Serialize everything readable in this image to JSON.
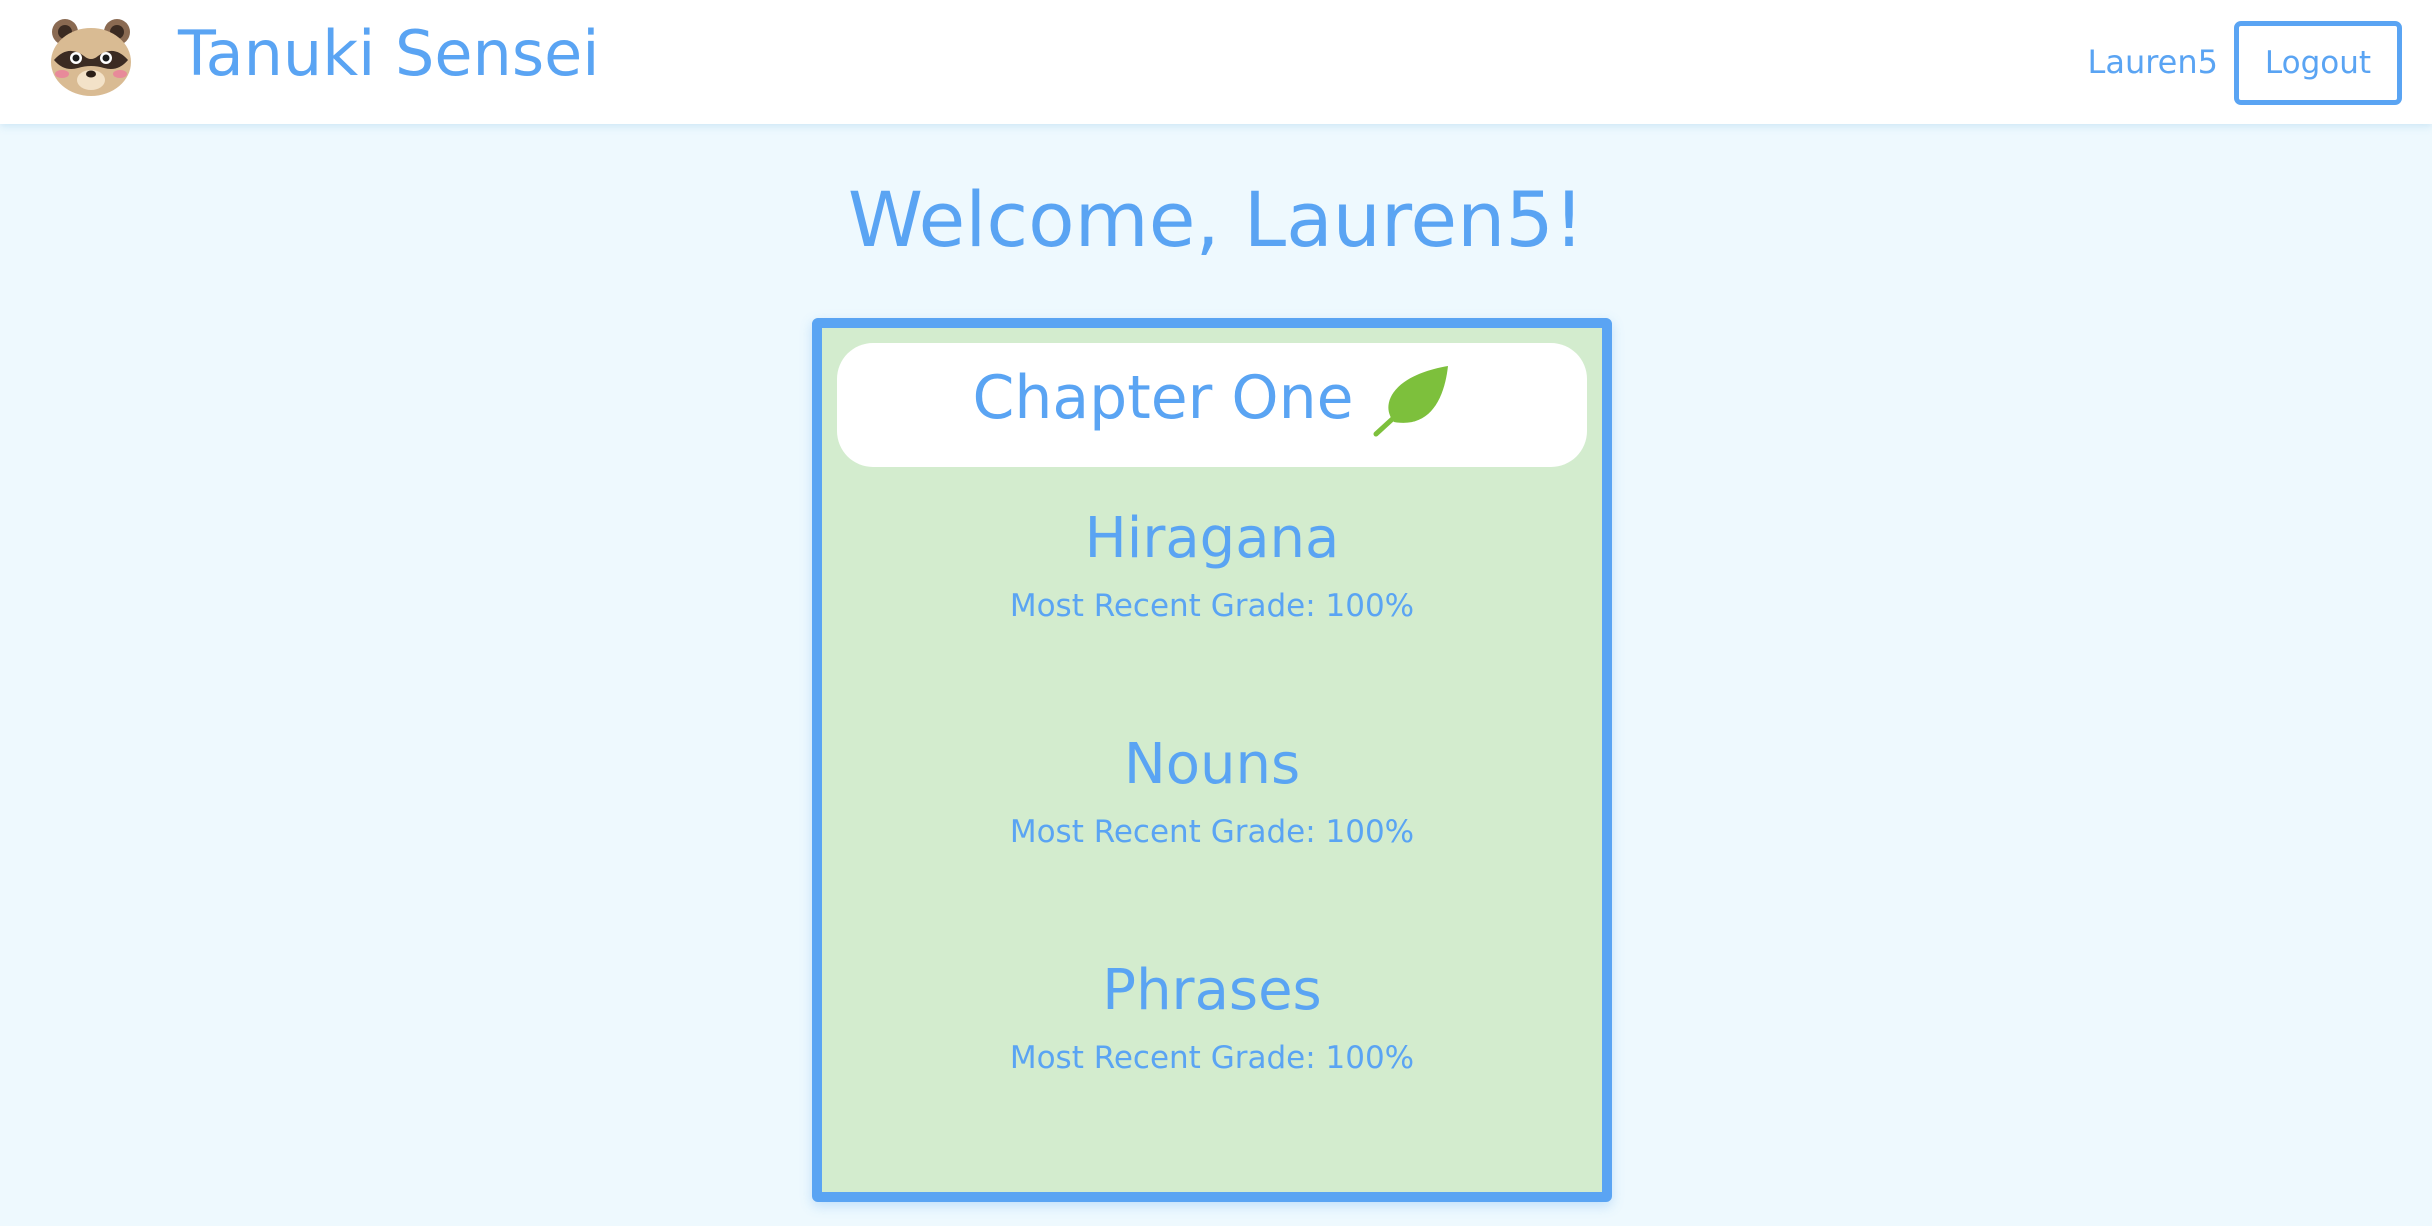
{
  "navbar": {
    "logo_icon": "tanuki-face-icon",
    "brand": "Tanuki Sensei",
    "username": "Lauren5",
    "logout_label": "Logout"
  },
  "welcome": "Welcome, Lauren5!",
  "chapter": {
    "title": "Chapter One",
    "icon": "leaf-icon",
    "lessons": [
      {
        "title": "Hiragana",
        "grade_label": "Most Recent Grade: ",
        "grade_value": "100%"
      },
      {
        "title": "Nouns",
        "grade_label": "Most Recent Grade: ",
        "grade_value": "100%"
      },
      {
        "title": "Phrases",
        "grade_label": "Most Recent Grade: ",
        "grade_value": "100%"
      }
    ]
  },
  "colors": {
    "accent": "#5aa4f3",
    "page_bg": "#eef9fe",
    "card_bg": "#d3ecce",
    "leaf": "#7dc03c"
  }
}
